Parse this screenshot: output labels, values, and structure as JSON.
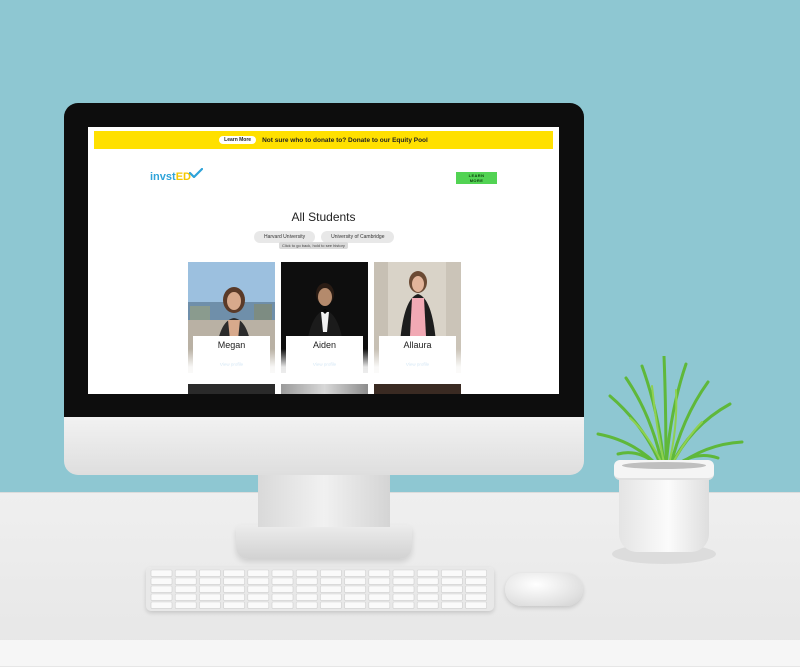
{
  "banner": {
    "button_label": "Learn More",
    "text": "Not sure who to donate to? Donate to our Equity Pool",
    "color": "#ffe000"
  },
  "header": {
    "logo_part_1": "invst",
    "logo_part_2": "ED",
    "learn_more_label": "LEARN MORE",
    "learn_more_color": "#52d353"
  },
  "main": {
    "title": "All Students",
    "filters": [
      "Harvard University",
      "University of Cambridge"
    ],
    "hint": "Click to go back, hold to see history"
  },
  "students": [
    {
      "name": "Megan",
      "link": "View profile"
    },
    {
      "name": "Aiden",
      "link": "View profile"
    },
    {
      "name": "Allaura",
      "link": "View profile"
    }
  ],
  "colors": {
    "wall": "#8ec7d2",
    "logo_blue": "#2ea3d9",
    "logo_yellow": "#f5c800",
    "link_blue": "#3a8fd0"
  }
}
